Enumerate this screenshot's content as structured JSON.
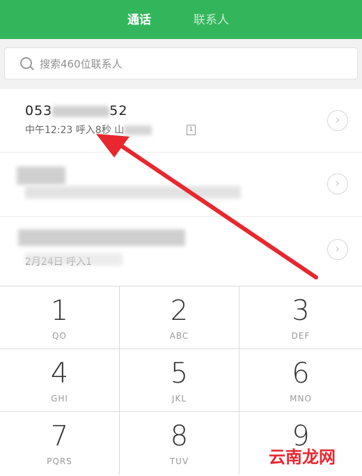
{
  "tabs": {
    "calls": "通话",
    "contacts": "联系人"
  },
  "search": {
    "placeholder": "搜索460位联系人"
  },
  "calls": [
    {
      "number_start": "053",
      "number_end": "52",
      "time": "中午12:23",
      "detail_partial": "呼入8秒",
      "location_partial": "山",
      "sim": "1"
    },
    {},
    {
      "detail": "2月24日 呼入1"
    }
  ],
  "keypad": [
    {
      "digit": "1",
      "letters": "QO"
    },
    {
      "digit": "2",
      "letters": "ABC"
    },
    {
      "digit": "3",
      "letters": "DEF"
    },
    {
      "digit": "4",
      "letters": "GHI"
    },
    {
      "digit": "5",
      "letters": "JKL"
    },
    {
      "digit": "6",
      "letters": "MNO"
    },
    {
      "digit": "7",
      "letters": "PQRS"
    },
    {
      "digit": "8",
      "letters": "TUV"
    },
    {
      "digit": "9",
      "letters": ""
    }
  ],
  "colors": {
    "brand": "#33b55c",
    "annotation": "#e8272e"
  },
  "watermark": "云南龙网"
}
